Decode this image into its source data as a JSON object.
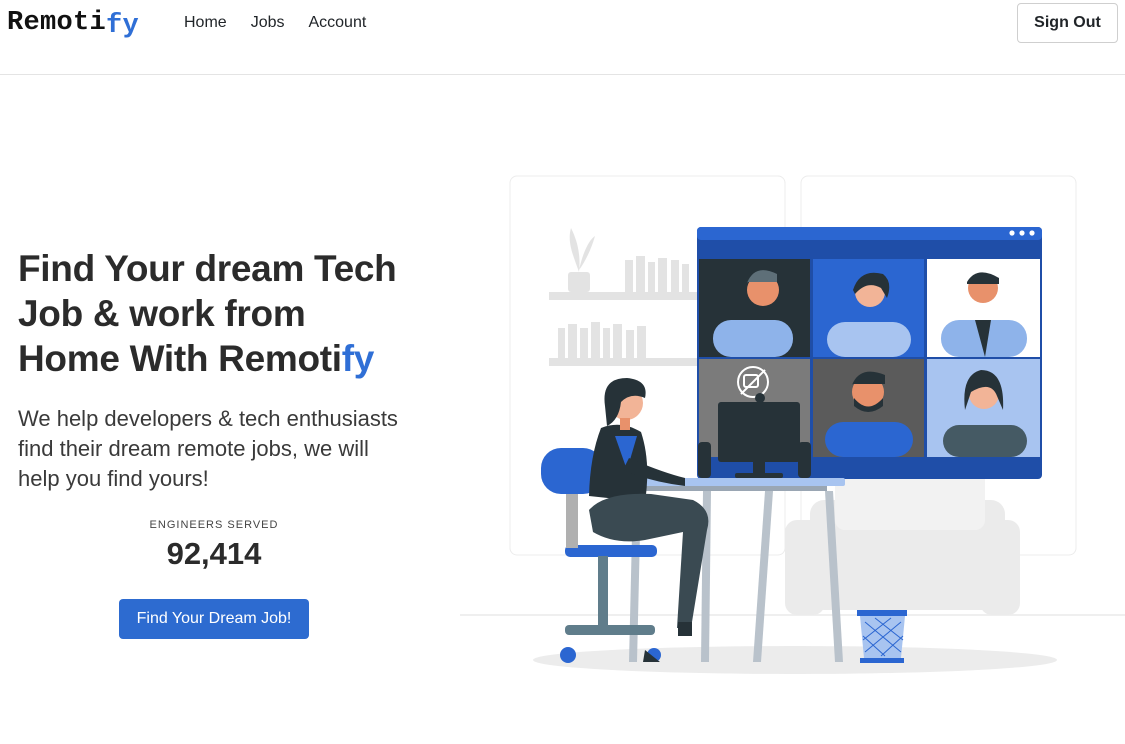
{
  "brand": {
    "prefix": "Remoti",
    "suffix": "fy"
  },
  "nav": {
    "items": [
      {
        "label": "Home"
      },
      {
        "label": "Jobs"
      },
      {
        "label": "Account"
      }
    ]
  },
  "header": {
    "signout_label": "Sign Out"
  },
  "hero": {
    "title_line1": "Find Your dream Tech",
    "title_line2": "Job & work from",
    "title_line3_prefix": "Home With Remoti",
    "title_line3_accent": "fy",
    "subtitle": "We help developers & tech enthusiasts find their dream remote jobs, we will help you find yours!",
    "stat_label": "ENGINEERS SERVED",
    "stat_value": "92,414",
    "cta_label": "Find Your Dream Job!"
  },
  "illustration": {
    "icon": "video-conference-illustration"
  },
  "colors": {
    "accent": "#2f6fd6",
    "button": "#2d6bd0",
    "text": "#212529"
  }
}
